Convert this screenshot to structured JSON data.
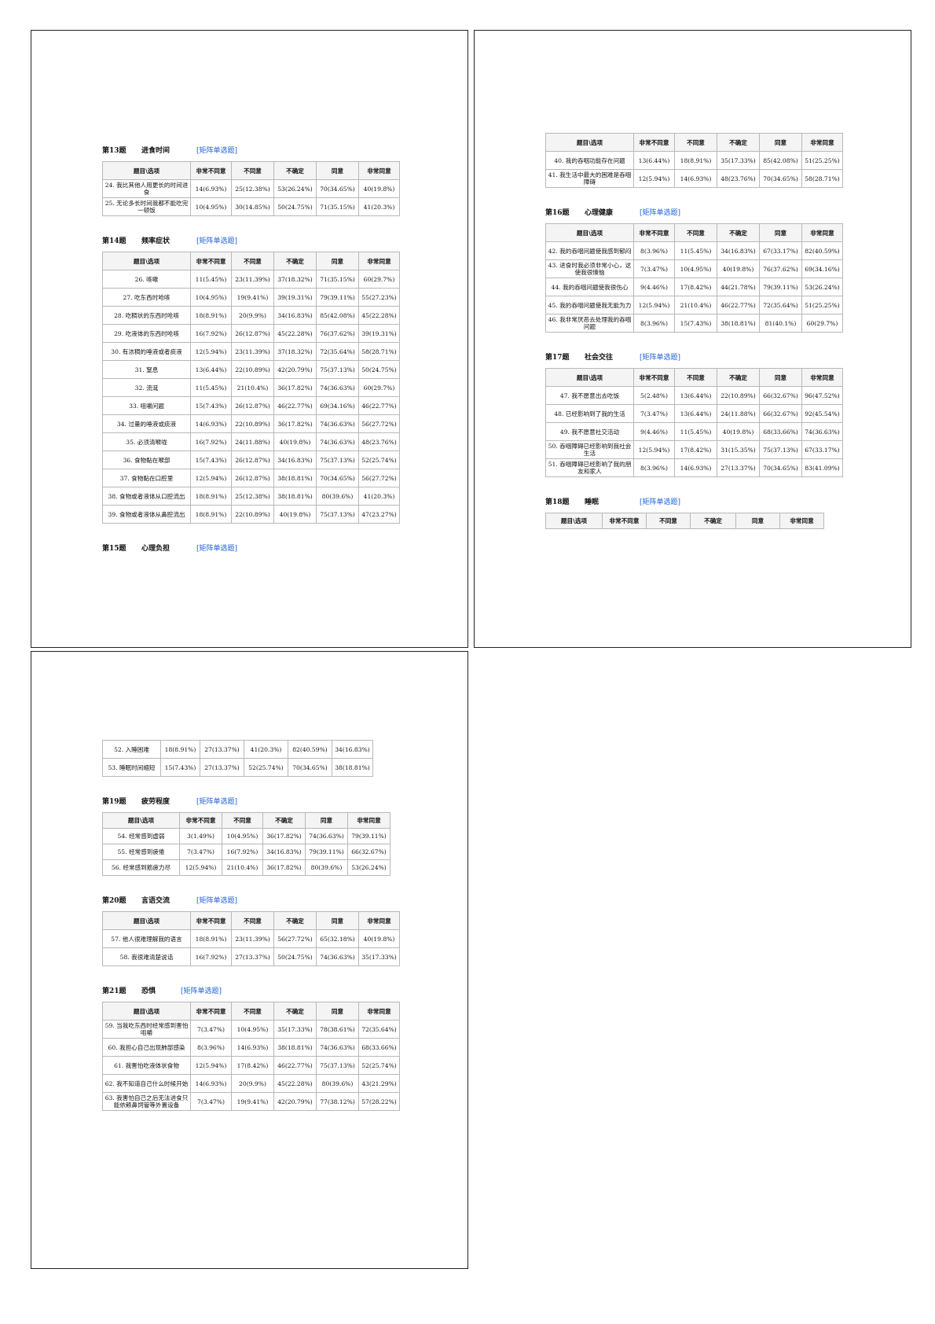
{
  "headers": [
    "题目\\选项",
    "非常不同意",
    "不同意",
    "不确定",
    "同意",
    "非常同意"
  ],
  "pages": {
    "p1": {
      "q13": {
        "no": "第13题",
        "title": "进食时间",
        "type": "[矩阵单选题]",
        "rows": [
          [
            "24. 我比其他人用更长的时间进食",
            "14(6.93%)",
            "25(12.38%)",
            "53(26.24%)",
            "70(34.65%)",
            "40(19.8%)"
          ],
          [
            "25. 无论多长时间我都不能吃完一顿饭",
            "10(4.95%)",
            "30(14.85%)",
            "50(24.75%)",
            "71(35.15%)",
            "41(20.3%)"
          ]
        ]
      },
      "q14": {
        "no": "第14题",
        "title": "频率症状",
        "type": "[矩阵单选题]",
        "rows": [
          [
            "26. 咳嗽",
            "11(5.45%)",
            "23(11.39%)",
            "37(18.32%)",
            "71(35.15%)",
            "60(29.7%)"
          ],
          [
            "27. 吃东西时呛咳",
            "10(4.95%)",
            "19(9.41%)",
            "39(19.31%)",
            "79(39.11%)",
            "55(27.23%)"
          ],
          [
            "28. 吃稠状的东西时呛咳",
            "18(8.91%)",
            "20(9.9%)",
            "34(16.83%)",
            "85(42.08%)",
            "45(22.28%)"
          ],
          [
            "29. 吃液体的东西时呛咳",
            "16(7.92%)",
            "26(12.87%)",
            "45(22.28%)",
            "76(37.62%)",
            "39(19.31%)"
          ],
          [
            "30. 有浓稠的唾液或者痰液",
            "12(5.94%)",
            "23(11.39%)",
            "37(18.32%)",
            "72(35.64%)",
            "58(28.71%)"
          ],
          [
            "31. 窒息",
            "13(6.44%)",
            "22(10.89%)",
            "42(20.79%)",
            "75(37.13%)",
            "50(24.75%)"
          ],
          [
            "32. 流涎",
            "11(5.45%)",
            "21(10.4%)",
            "36(17.82%)",
            "74(36.63%)",
            "60(29.7%)"
          ],
          [
            "33. 咀嚼问题",
            "15(7.43%)",
            "26(12.87%)",
            "46(22.77%)",
            "69(34.16%)",
            "46(22.77%)"
          ],
          [
            "34. 过量的唾液或痰液",
            "14(6.93%)",
            "22(10.89%)",
            "36(17.82%)",
            "74(36.63%)",
            "56(27.72%)"
          ],
          [
            "35. 必须清喉咙",
            "16(7.92%)",
            "24(11.88%)",
            "40(19.8%)",
            "74(36.63%)",
            "48(23.76%)"
          ],
          [
            "36. 食物黏在喉部",
            "15(7.43%)",
            "26(12.87%)",
            "34(16.83%)",
            "75(37.13%)",
            "52(25.74%)"
          ],
          [
            "37. 食物黏在口腔里",
            "12(5.94%)",
            "26(12.87%)",
            "38(18.81%)",
            "70(34.65%)",
            "56(27.72%)"
          ],
          [
            "38. 食物或者液体从口腔流出",
            "18(8.91%)",
            "25(12.38%)",
            "38(18.81%)",
            "80(39.6%)",
            "41(20.3%)"
          ],
          [
            "39. 食物或者液体从鼻腔流出",
            "18(8.91%)",
            "22(10.89%)",
            "40(19.8%)",
            "75(37.13%)",
            "47(23.27%)"
          ]
        ]
      },
      "q15": {
        "no": "第15题",
        "title": "心理负担",
        "type": "[矩阵单选题]"
      }
    },
    "p2": {
      "q15cont": {
        "rows": [
          [
            "40. 我的吞咽功能存在问题",
            "13(6.44%)",
            "18(8.91%)",
            "35(17.33%)",
            "85(42.08%)",
            "51(25.25%)"
          ],
          [
            "41. 我生活中最大的困难是吞咽障碍",
            "12(5.94%)",
            "14(6.93%)",
            "48(23.76%)",
            "70(34.65%)",
            "58(28.71%)"
          ]
        ]
      },
      "q16": {
        "no": "第16题",
        "title": "心理健康",
        "type": "[矩阵单选题]",
        "rows": [
          [
            "42. 我的吞咽问题使我感到郁闷",
            "8(3.96%)",
            "11(5.45%)",
            "34(16.83%)",
            "67(33.17%)",
            "82(40.59%)"
          ],
          [
            "43. 进食时我必须非常小心，这使我很懊恼",
            "7(3.47%)",
            "10(4.95%)",
            "40(19.8%)",
            "76(37.62%)",
            "69(34.16%)"
          ],
          [
            "44. 我的吞咽问题使我很伤心",
            "9(4.46%)",
            "17(8.42%)",
            "44(21.78%)",
            "79(39.11%)",
            "53(26.24%)"
          ],
          [
            "45. 我的吞咽问题使我无能为力",
            "12(5.94%)",
            "21(10.4%)",
            "46(22.77%)",
            "72(35.64%)",
            "51(25.25%)"
          ],
          [
            "46. 我非常厌恶去处理我的吞咽问题",
            "8(3.96%)",
            "15(7.43%)",
            "38(18.81%)",
            "81(40.1%)",
            "60(29.7%)"
          ]
        ]
      },
      "q17": {
        "no": "第17题",
        "title": "社会交往",
        "type": "[矩阵单选题]",
        "rows": [
          [
            "47. 我不愿意出去吃饭",
            "5(2.48%)",
            "13(6.44%)",
            "22(10.89%)",
            "66(32.67%)",
            "96(47.52%)"
          ],
          [
            "48. 已经影响到了我的生活",
            "7(3.47%)",
            "13(6.44%)",
            "24(11.88%)",
            "66(32.67%)",
            "92(45.54%)"
          ],
          [
            "49. 我不愿意社交活动",
            "9(4.46%)",
            "11(5.45%)",
            "40(19.8%)",
            "68(33.66%)",
            "74(36.63%)"
          ],
          [
            "50. 吞咽障碍已经影响到我社会生活",
            "12(5.94%)",
            "17(8.42%)",
            "31(15.35%)",
            "75(37.13%)",
            "67(33.17%)"
          ],
          [
            "51. 吞咽障碍已经影响了我的朋友和家人",
            "8(3.96%)",
            "14(6.93%)",
            "27(13.37%)",
            "70(34.65%)",
            "83(41.09%)"
          ]
        ]
      },
      "q18": {
        "no": "第18题",
        "title": "睡眠",
        "type": "[矩阵单选题]"
      }
    },
    "p3": {
      "q18cont": {
        "rows": [
          [
            "52. 入睡困难",
            "18(8.91%)",
            "27(13.37%)",
            "41(20.3%)",
            "82(40.59%)",
            "34(16.83%)"
          ],
          [
            "53. 睡眠时间缩短",
            "15(7.43%)",
            "27(13.37%)",
            "52(25.74%)",
            "70(34.65%)",
            "38(18.81%)"
          ]
        ]
      },
      "q19": {
        "no": "第19题",
        "title": "疲劳程度",
        "type": "[矩阵单选题]",
        "rows": [
          [
            "54. 经常感到虚弱",
            "3(1.49%)",
            "10(4.95%)",
            "36(17.82%)",
            "74(36.63%)",
            "79(39.11%)"
          ],
          [
            "55. 经常感到疲倦",
            "7(3.47%)",
            "16(7.92%)",
            "34(16.83%)",
            "79(39.11%)",
            "66(32.67%)"
          ],
          [
            "56. 经常感到筋疲力尽",
            "12(5.94%)",
            "21(10.4%)",
            "36(17.82%)",
            "80(39.6%)",
            "53(26.24%)"
          ]
        ]
      },
      "q20": {
        "no": "第20题",
        "title": "言语交流",
        "type": "[矩阵单选题]",
        "rows": [
          [
            "57. 他人很难理解我的语言",
            "18(8.91%)",
            "23(11.39%)",
            "56(27.72%)",
            "65(32.18%)",
            "40(19.8%)"
          ],
          [
            "58. 我很难清楚说话",
            "16(7.92%)",
            "27(13.37%)",
            "50(24.75%)",
            "74(36.63%)",
            "35(17.33%)"
          ]
        ]
      },
      "q21": {
        "no": "第21题",
        "title": "恐惧",
        "type": "[矩阵单选题]",
        "rows": [
          [
            "59. 当我吃东西时经常感到害怕咀嚼",
            "7(3.47%)",
            "10(4.95%)",
            "35(17.33%)",
            "78(38.61%)",
            "72(35.64%)"
          ],
          [
            "60. 我担心自己出现肺部感染",
            "8(3.96%)",
            "14(6.93%)",
            "38(18.81%)",
            "74(36.63%)",
            "68(33.66%)"
          ],
          [
            "61. 我害怕吃液体状食物",
            "12(5.94%)",
            "17(8.42%)",
            "46(22.77%)",
            "75(37.13%)",
            "52(25.74%)"
          ],
          [
            "62. 我不知道自己什么时候开始",
            "14(6.93%)",
            "20(9.9%)",
            "45(22.28%)",
            "80(39.6%)",
            "43(21.29%)"
          ],
          [
            "63. 我害怕自己之后无法进食只能依赖鼻饲管等外置设备",
            "7(3.47%)",
            "19(9.41%)",
            "42(20.79%)",
            "77(38.12%)",
            "57(28.22%)"
          ]
        ]
      }
    }
  }
}
